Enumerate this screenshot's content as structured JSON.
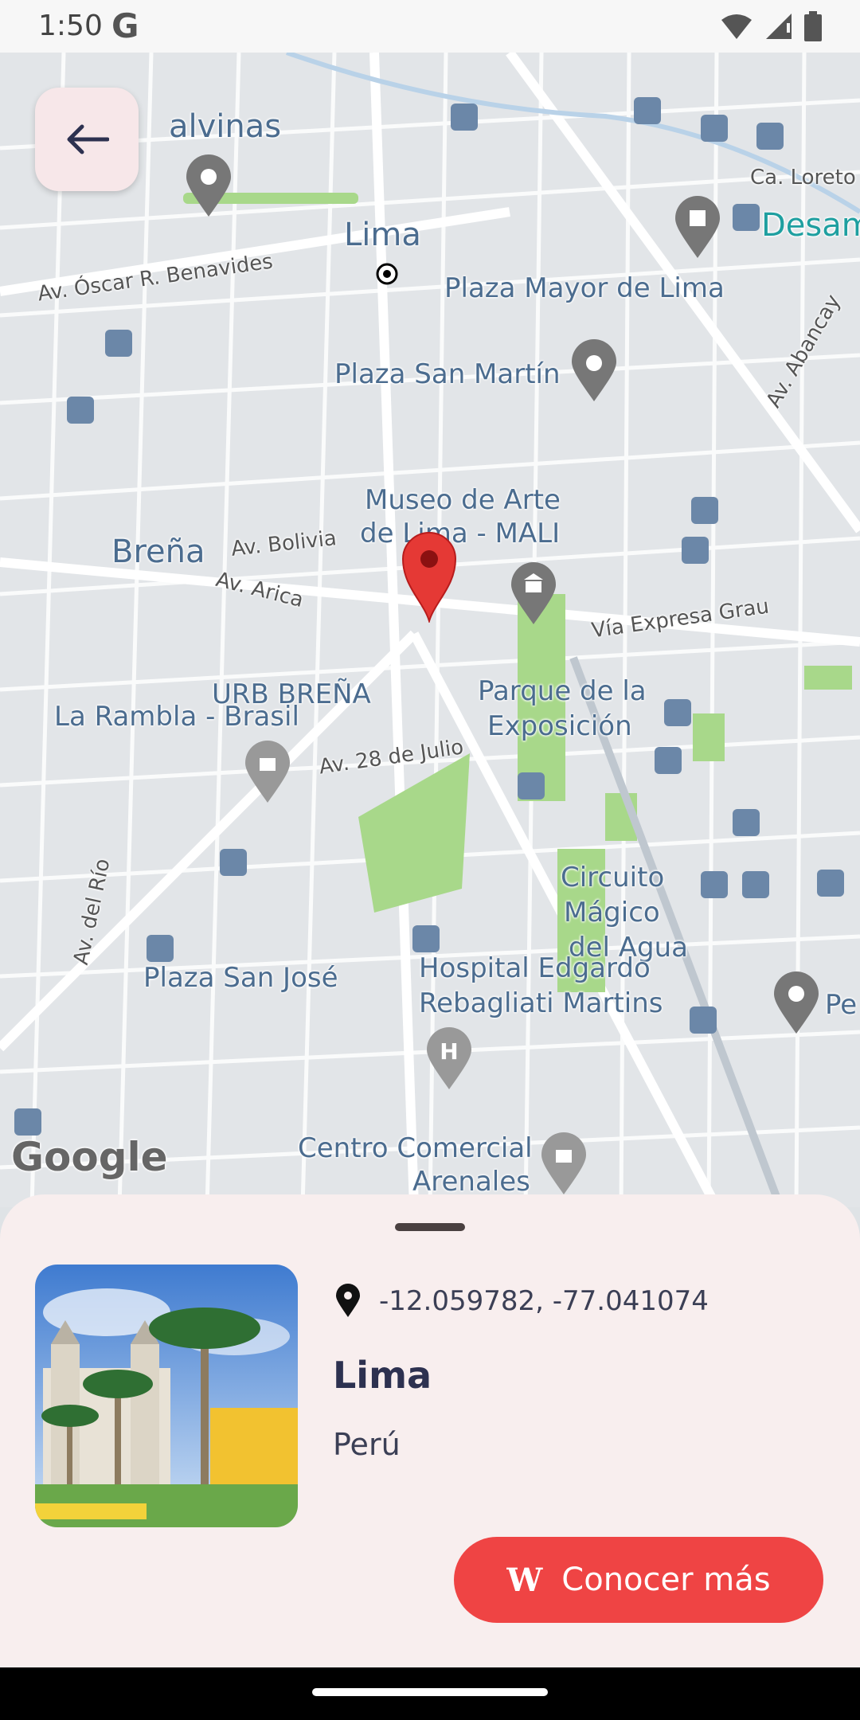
{
  "status_bar": {
    "time": "1:50",
    "google_badge": "G",
    "icons": [
      "wifi-icon",
      "signal-icon",
      "battery-icon"
    ]
  },
  "map": {
    "labels": {
      "malvinas": "alvinas",
      "lima": "Lima",
      "ca_loreto": "Ca. Loreto",
      "desamp": "Desamp",
      "av_oscar": "Av. Óscar R. Benavides",
      "plaza_mayor": "Plaza Mayor de Lima",
      "av_abancay": "Av. Abancay",
      "plaza_san_martin": "Plaza San Martín",
      "museo": "Museo de Arte",
      "museo2": "de Lima - MALI",
      "brena": "Breña",
      "av_bolivia": "Av. Bolivia",
      "av_arica": "Av. Arica",
      "via_expresa": "Vía Expresa Grau",
      "urb_brena": "URB BREÑA",
      "rambla": "La Rambla - Brasil",
      "parque1": "Parque de la",
      "parque2": "Exposición",
      "av_28": "Av. 28 de Julio",
      "circuito1": "Circuito",
      "circuito2": "Mágico",
      "circuito3": "del Agua",
      "av_rio": "Av. del Río",
      "plaza_san_jose": "Plaza San José",
      "hospital1": "Hospital Edgardo",
      "hospital2": "Rebagliati Martins",
      "pe": "Pe",
      "centro1": "Centro Comercial",
      "centro2": "Arenales"
    },
    "google_logo": "Google"
  },
  "back_button": {
    "icon": "arrow-left-icon"
  },
  "place": {
    "coordinates": "-12.059782, -77.041074",
    "title": "Lima",
    "country": "Perú",
    "cta_label": "Conocer más",
    "cta_icon_glyph": "W"
  },
  "colors": {
    "accent": "#ef4444",
    "sheet_bg": "#f8eeee",
    "title": "#2d3150",
    "map_park": "#a8d88a",
    "marker": "#e53935"
  }
}
